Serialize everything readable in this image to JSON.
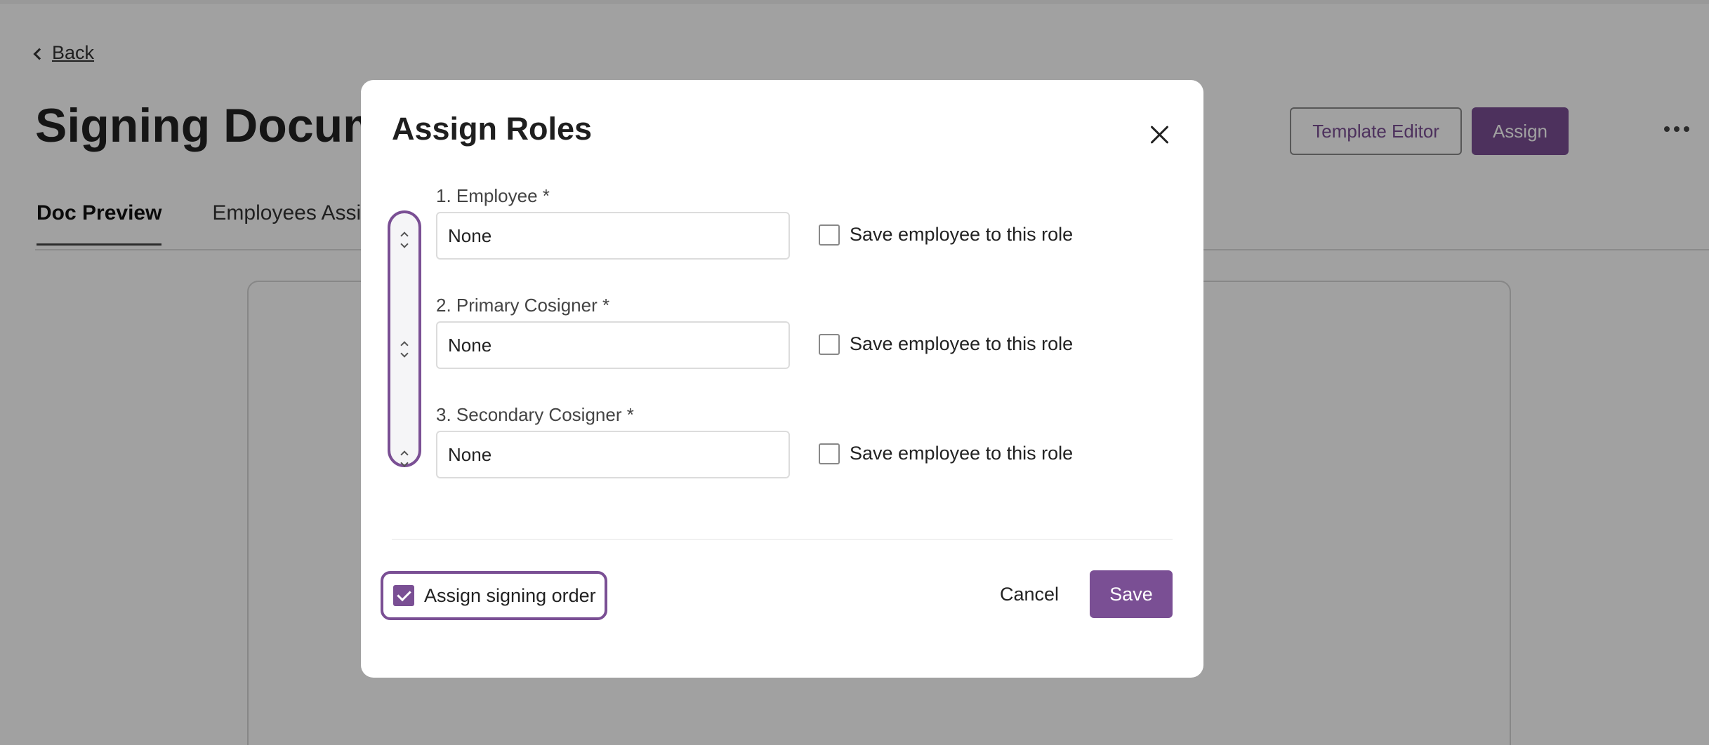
{
  "page": {
    "back_label": "Back",
    "title": "Signing Documents",
    "template_editor_label": "Template Editor",
    "assign_label": "Assign",
    "tabs": [
      {
        "label": "Doc Preview"
      },
      {
        "label": "Employees Assigned"
      }
    ]
  },
  "modal": {
    "title": "Assign Roles",
    "roles": [
      {
        "label": "1. Employee *",
        "value": "None",
        "save_label": "Save employee to this role"
      },
      {
        "label": "2. Primary Cosigner *",
        "value": "None",
        "save_label": "Save employee to this role"
      },
      {
        "label": "3. Secondary Cosigner *",
        "value": "None",
        "save_label": "Save employee to this role"
      }
    ],
    "signing_order_label": "Assign signing order",
    "signing_order_checked": true,
    "cancel_label": "Cancel",
    "save_label": "Save"
  },
  "colors": {
    "accent": "#7a4f94",
    "overlay": "rgba(0,0,0,0.37)"
  },
  "icons": {
    "back": "chevron-left-icon",
    "close": "close-icon",
    "more": "more-horizontal-icon",
    "reorder": "chevron-up-down-icon"
  }
}
